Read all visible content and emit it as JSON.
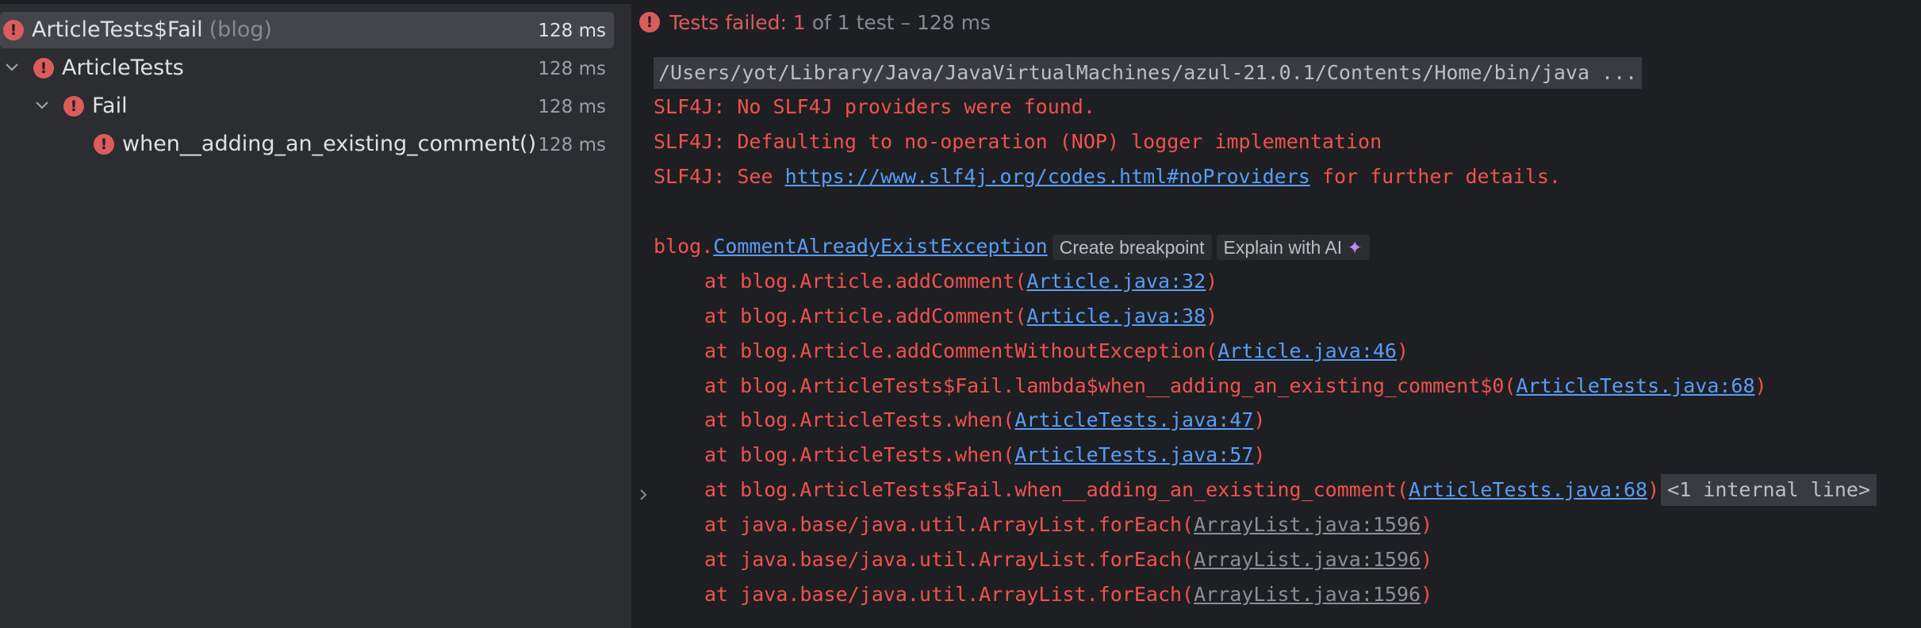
{
  "tree": {
    "items": [
      {
        "name": "ArticleTests$Fail",
        "pkg": "(blog)",
        "duration": "128 ms"
      },
      {
        "name": "ArticleTests",
        "duration": "128 ms"
      },
      {
        "name": "Fail",
        "duration": "128 ms"
      },
      {
        "name": "when__adding_an_existing_comment()",
        "duration": "128 ms"
      }
    ]
  },
  "status": {
    "icon": "error-icon",
    "failed_label": "Tests failed: 1",
    "rest": " of 1 test – 128 ms"
  },
  "console": {
    "command": "/Users/yot/Library/Java/JavaVirtualMachines/azul-21.0.1/Contents/Home/bin/java ...",
    "slf4j_1": "SLF4J: No SLF4J providers were found.",
    "slf4j_2": "SLF4J: Defaulting to no-operation (NOP) logger implementation",
    "slf4j_3_prefix": "SLF4J: See ",
    "slf4j_3_link": "https://www.slf4j.org/codes.html#noProviders",
    "slf4j_3_suffix": " for further details.",
    "exception_pkg": "blog.",
    "exception_class": "CommentAlreadyExistException",
    "create_breakpoint": "Create breakpoint",
    "explain_ai": "Explain with AI",
    "frames": [
      {
        "text": "at blog.Article.addComment(",
        "link": "Article.java:32",
        "close": ")"
      },
      {
        "text": "at blog.Article.addComment(",
        "link": "Article.java:38",
        "close": ")"
      },
      {
        "text": "at blog.Article.addCommentWithoutException(",
        "link": "Article.java:46",
        "close": ")"
      },
      {
        "text": "at blog.ArticleTests$Fail.lambda$when__adding_an_existing_comment$0(",
        "link": "ArticleTests.java:68",
        "close": ")"
      },
      {
        "text": "at blog.ArticleTests.when(",
        "link": "ArticleTests.java:47",
        "close": ")"
      },
      {
        "text": "at blog.ArticleTests.when(",
        "link": "ArticleTests.java:57",
        "close": ")"
      },
      {
        "text": "at blog.ArticleTests$Fail.when__adding_an_existing_comment(",
        "link": "ArticleTests.java:68",
        "close": ")",
        "extra": "<1 internal line>"
      },
      {
        "text": "at java.base/java.util.ArrayList.forEach(",
        "link": "ArrayList.java:1596",
        "close": ")"
      },
      {
        "text": "at java.base/java.util.ArrayList.forEach(",
        "link": "ArrayList.java:1596",
        "close": ")"
      },
      {
        "text": "at java.base/java.util.ArrayList.forEach(",
        "link": "ArrayList.java:1596",
        "close": ")"
      }
    ]
  },
  "colors": {
    "error": "#db5c5c",
    "console_error": "#f0524f",
    "link": "#589df6",
    "background": "#1e1f22",
    "panel": "#2b2d30"
  }
}
